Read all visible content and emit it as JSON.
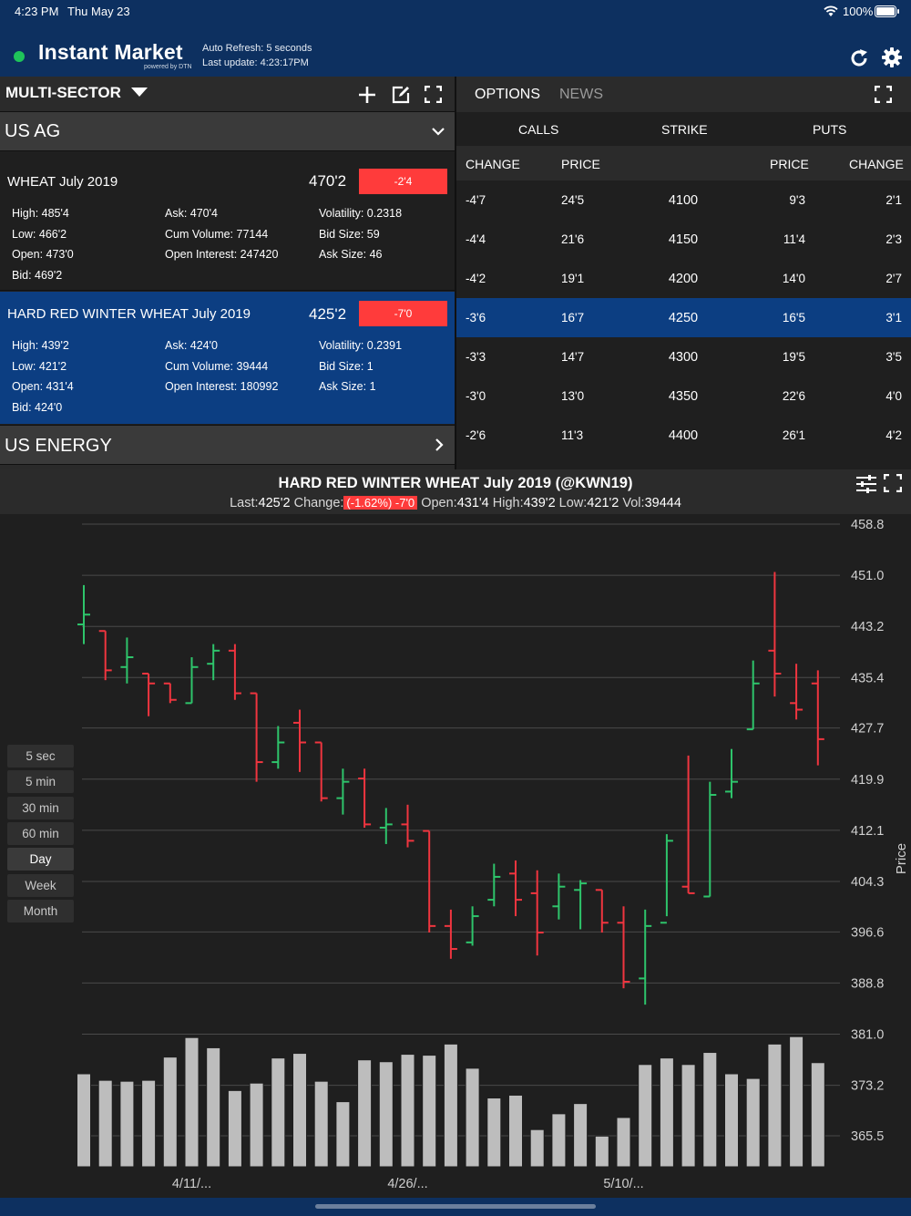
{
  "status_bar": {
    "time": "4:23 PM",
    "date": "Thu May 23",
    "battery": "100%"
  },
  "header": {
    "brand": "Instant Market",
    "powered_by": "powered by DTN",
    "auto_refresh": "Auto Refresh: 5 seconds",
    "last_update": "Last update: 4:23:17PM"
  },
  "left_panel": {
    "title": "MULTI-SECTOR",
    "sectors": [
      {
        "name": "US AG"
      },
      {
        "name": "US ENERGY"
      }
    ],
    "quotes": [
      {
        "name": "WHEAT July 2019",
        "last": "470'2",
        "change": "-2'4",
        "high": "High: 485'4",
        "low": "Low: 466'2",
        "open": "Open: 473'0",
        "bid": "Bid: 469'2",
        "ask": "Ask: 470'4",
        "cum_volume": "Cum Volume: 77144",
        "open_interest": "Open Interest: 247420",
        "volatility": "Volatility: 0.2318",
        "bid_size": "Bid Size: 59",
        "ask_size": "Ask Size: 46"
      },
      {
        "name": "HARD RED WINTER WHEAT July 2019",
        "last": "425'2",
        "change": "-7'0",
        "high": "High: 439'2",
        "low": "Low: 421'2",
        "open": "Open: 431'4",
        "bid": "Bid: 424'0",
        "ask": "Ask: 424'0",
        "cum_volume": "Cum Volume: 39444",
        "open_interest": "Open Interest: 180992",
        "volatility": "Volatility: 0.2391",
        "bid_size": "Bid Size: 1",
        "ask_size": "Ask Size: 1"
      }
    ]
  },
  "options_panel": {
    "tabs": [
      "OPTIONS",
      "NEWS"
    ],
    "group_headers": {
      "calls": "CALLS",
      "strike": "STRIKE",
      "puts": "PUTS"
    },
    "col_headers": {
      "call_change": "CHANGE",
      "call_price": "PRICE",
      "put_price": "PRICE",
      "put_change": "CHANGE"
    },
    "rows": [
      {
        "call_change": "-4'7",
        "call_price": "24'5",
        "strike": "4100",
        "put_price": "9'3",
        "put_change": "2'1"
      },
      {
        "call_change": "-4'4",
        "call_price": "21'6",
        "strike": "4150",
        "put_price": "11'4",
        "put_change": "2'3"
      },
      {
        "call_change": "-4'2",
        "call_price": "19'1",
        "strike": "4200",
        "put_price": "14'0",
        "put_change": "2'7"
      },
      {
        "call_change": "-3'6",
        "call_price": "16'7",
        "strike": "4250",
        "put_price": "16'5",
        "put_change": "3'1"
      },
      {
        "call_change": "-3'3",
        "call_price": "14'7",
        "strike": "4300",
        "put_price": "19'5",
        "put_change": "3'5"
      },
      {
        "call_change": "-3'0",
        "call_price": "13'0",
        "strike": "4350",
        "put_price": "22'6",
        "put_change": "4'0"
      },
      {
        "call_change": "-2'6",
        "call_price": "11'3",
        "strike": "4400",
        "put_price": "26'1",
        "put_change": "4'2"
      }
    ],
    "selected_strike": "4250"
  },
  "chart_panel": {
    "title": "HARD RED WINTER WHEAT July 2019  (@KWN19)",
    "sub_last_label": "Last:",
    "sub_last": "425'2",
    "sub_change_label": "Change:",
    "sub_change_badge": "(-1.62%) -7'0",
    "sub_open_label": "Open:",
    "sub_open": "431'4",
    "sub_high_label": "High:",
    "sub_high": "439'2",
    "sub_low_label": "Low:",
    "sub_low": "421'2",
    "sub_vol_label": "Vol:",
    "sub_vol": "39444",
    "timeframes": [
      "5 sec",
      "5 min",
      "30 min",
      "60 min",
      "Day",
      "Week",
      "Month"
    ],
    "active_timeframe": "Day"
  },
  "colors": {
    "up": "#2ec46b",
    "down": "#f0353f",
    "header_bg": "#0d3060",
    "selected_bg": "#0c3e82",
    "badge_red": "#ff3b3b"
  },
  "chart_data": {
    "type": "ohlc",
    "ylabel": "Price",
    "yticks": [
      458.8,
      451.0,
      443.2,
      435.4,
      427.7,
      419.9,
      412.1,
      404.3,
      396.6,
      388.8,
      381.0,
      373.2,
      365.5
    ],
    "ylim": [
      365.5,
      458.8
    ],
    "xtick_labels": [
      {
        "label": "4/11/...",
        "index": 5
      },
      {
        "label": "4/26/...",
        "index": 15
      },
      {
        "label": "5/10/...",
        "index": 25
      }
    ],
    "grid": true,
    "bars": [
      {
        "o": 443.5,
        "h": 449.5,
        "l": 440.5,
        "c": 445.0,
        "v": 1.0
      },
      {
        "o": 442.5,
        "h": 442.5,
        "l": 435.0,
        "c": 436.5,
        "v": 0.93
      },
      {
        "o": 437.0,
        "h": 441.5,
        "l": 434.5,
        "c": 438.5,
        "v": 0.92
      },
      {
        "o": 436.0,
        "h": 436.0,
        "l": 429.5,
        "c": 434.5,
        "v": 0.93
      },
      {
        "o": 434.5,
        "h": 434.5,
        "l": 431.5,
        "c": 432.0,
        "v": 1.18
      },
      {
        "o": 431.5,
        "h": 438.5,
        "l": 431.5,
        "c": 437.0,
        "v": 1.39
      },
      {
        "o": 437.5,
        "h": 440.5,
        "l": 435.0,
        "c": 439.5,
        "v": 1.28
      },
      {
        "o": 439.5,
        "h": 440.5,
        "l": 432.0,
        "c": 433.0,
        "v": 0.82
      },
      {
        "o": 433.0,
        "h": 433.0,
        "l": 419.5,
        "c": 422.5,
        "v": 0.9
      },
      {
        "o": 422.5,
        "h": 428.0,
        "l": 421.5,
        "c": 425.5,
        "v": 1.17
      },
      {
        "o": 428.5,
        "h": 430.5,
        "l": 421.0,
        "c": 425.5,
        "v": 1.22
      },
      {
        "o": 425.5,
        "h": 425.5,
        "l": 416.5,
        "c": 417.0,
        "v": 0.92
      },
      {
        "o": 417.0,
        "h": 421.5,
        "l": 414.5,
        "c": 419.5,
        "v": 0.7
      },
      {
        "o": 420.0,
        "h": 421.5,
        "l": 412.5,
        "c": 413.0,
        "v": 1.15
      },
      {
        "o": 412.5,
        "h": 415.5,
        "l": 410.0,
        "c": 413.0,
        "v": 1.13
      },
      {
        "o": 413.0,
        "h": 416.0,
        "l": 409.5,
        "c": 410.5,
        "v": 1.21
      },
      {
        "o": 412.0,
        "h": 412.0,
        "l": 396.5,
        "c": 397.5,
        "v": 1.2
      },
      {
        "o": 397.5,
        "h": 400.0,
        "l": 392.5,
        "c": 394.0,
        "v": 1.32
      },
      {
        "o": 395.0,
        "h": 400.5,
        "l": 394.5,
        "c": 399.0,
        "v": 1.06
      },
      {
        "o": 401.5,
        "h": 407.0,
        "l": 400.5,
        "c": 405.0,
        "v": 0.74
      },
      {
        "o": 405.5,
        "h": 407.5,
        "l": 399.0,
        "c": 401.5,
        "v": 0.77
      },
      {
        "o": 402.5,
        "h": 406.0,
        "l": 393.0,
        "c": 396.5,
        "v": 0.4
      },
      {
        "o": 400.5,
        "h": 405.5,
        "l": 398.5,
        "c": 403.5,
        "v": 0.57
      },
      {
        "o": 403.0,
        "h": 404.5,
        "l": 397.0,
        "c": 404.0,
        "v": 0.68
      },
      {
        "o": 403.0,
        "h": 403.0,
        "l": 396.5,
        "c": 398.0,
        "v": 0.33
      },
      {
        "o": 398.0,
        "h": 400.5,
        "l": 388.0,
        "c": 389.0,
        "v": 0.53
      },
      {
        "o": 389.5,
        "h": 400.0,
        "l": 385.5,
        "c": 397.5,
        "v": 1.1
      },
      {
        "o": 398.0,
        "h": 411.5,
        "l": 399.0,
        "c": 410.5,
        "v": 1.17
      },
      {
        "o": 403.5,
        "h": 423.5,
        "l": 402.5,
        "c": 402.5,
        "v": 1.1
      },
      {
        "o": 402.0,
        "h": 419.5,
        "l": 402.0,
        "c": 417.5,
        "v": 1.23
      },
      {
        "o": 418.0,
        "h": 424.5,
        "l": 417.0,
        "c": 419.5,
        "v": 1.0
      },
      {
        "o": 427.5,
        "h": 438.0,
        "l": 427.5,
        "c": 434.5,
        "v": 0.95
      },
      {
        "o": 439.5,
        "h": 451.5,
        "l": 432.5,
        "c": 436.0,
        "v": 1.32
      },
      {
        "o": 431.5,
        "h": 437.5,
        "l": 429.0,
        "c": 430.5,
        "v": 1.4
      },
      {
        "o": 434.5,
        "h": 436.5,
        "l": 422.0,
        "c": 426.0,
        "v": 1.12
      }
    ]
  }
}
